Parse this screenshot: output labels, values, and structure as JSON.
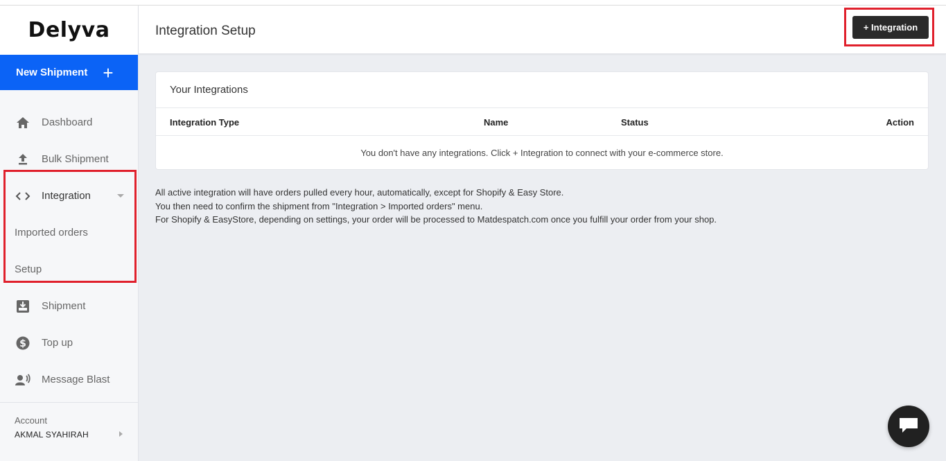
{
  "brand": {
    "logo_text": "Delyva",
    "accent_color": "#0b63f6"
  },
  "sidebar": {
    "new_shipment_label": "New Shipment",
    "items": [
      {
        "label": "Dashboard",
        "icon": "home-icon"
      },
      {
        "label": "Bulk Shipment",
        "icon": "upload-icon"
      },
      {
        "label": "Integration",
        "icon": "code-icon"
      },
      {
        "label": "Imported orders"
      },
      {
        "label": "Setup"
      },
      {
        "label": "Shipment",
        "icon": "inbox-download-icon"
      },
      {
        "label": "Top up",
        "icon": "dollar-icon"
      },
      {
        "label": "Message Blast",
        "icon": "broadcast-user-icon"
      }
    ],
    "account": {
      "label": "Account",
      "name": "AKMAL SYAHIRAH"
    }
  },
  "header": {
    "title": "Integration Setup",
    "add_button_label": "+ Integration"
  },
  "integrations_card": {
    "title": "Your Integrations",
    "columns": [
      "Integration Type",
      "Name",
      "Status",
      "Action"
    ],
    "empty_message": "You don't have any integrations. Click + Integration to connect with your e-commerce store."
  },
  "notes": [
    "All active integration will have orders pulled every hour, automatically, except for Shopify & Easy Store.",
    "You then need to confirm the shipment from \"Integration > Imported orders\" menu.",
    "For Shopify & EasyStore, depending on settings, your order will be processed to Matdespatch.com once you fulfill your order from your shop."
  ],
  "highlight_color": "#e0202c"
}
